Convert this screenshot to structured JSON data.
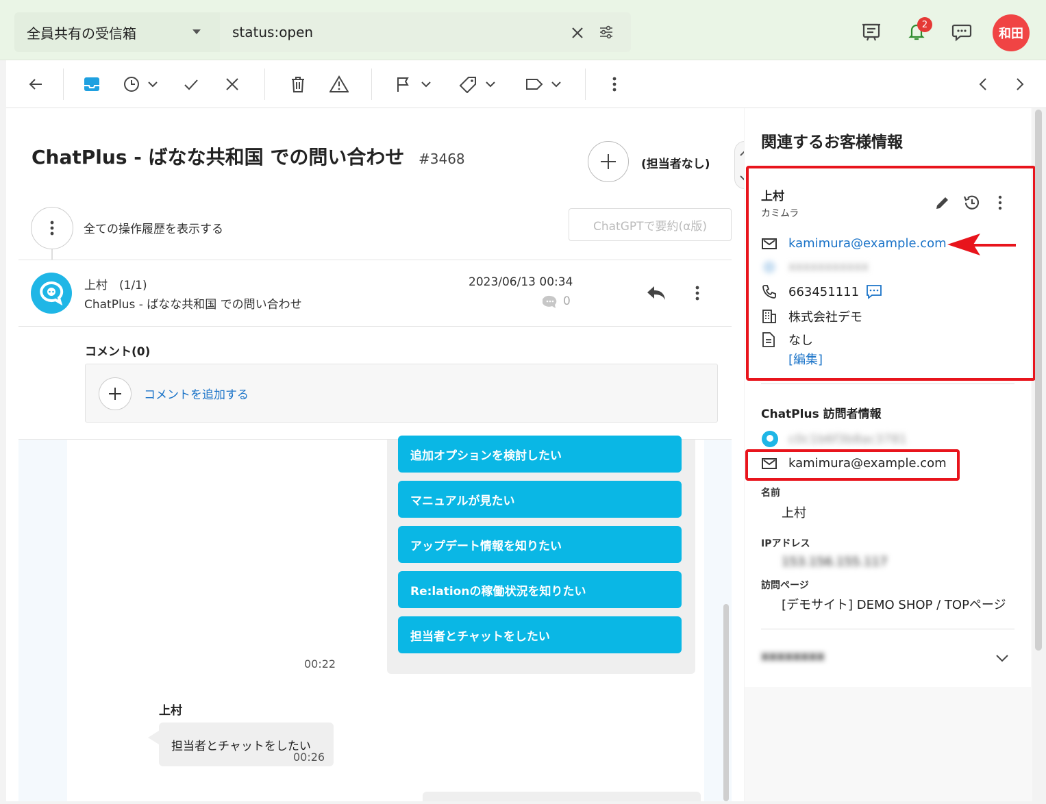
{
  "header": {
    "inbox": "全員共有の受信箱",
    "search_value": "status:open",
    "notification_count": "2",
    "user_initials": "和田"
  },
  "ticket": {
    "title": "ChatPlus - ばなな共和国 での問い合わせ",
    "number": "#3468",
    "assignee": "(担当者なし)",
    "history_label": "全ての操作履歴を表示する",
    "gpt_button": "ChatGPTで要約(α版)"
  },
  "message": {
    "from": "上村　(1/1)",
    "subject": "ChatPlus - ばなな共和国 での問い合わせ",
    "date": "2023/06/13 00:34",
    "comment_count": "0"
  },
  "comments": {
    "heading": "コメント(0)",
    "add_label": "コメントを追加する"
  },
  "chat": {
    "options": [
      "追加オプションを検討したい",
      "マニュアルが見たい",
      "アップデート情報を知りたい",
      "Re:lationの稼働状況を知りたい",
      "担当者とチャットをしたい"
    ],
    "bot_time": "00:22",
    "user_name": "上村",
    "user_message": "担当者とチャットをしたい",
    "user_time": "00:26"
  },
  "customer": {
    "section_title": "関連するお客様情報",
    "name": "上村",
    "kana": "カミムラ",
    "email": "kamimura@example.com",
    "blurred_contact": "xxxxxxxxxxx",
    "phone": "663451111",
    "company": "株式会社デモ",
    "memo": "なし",
    "edit_link": "[編集]"
  },
  "visitor": {
    "section_title": "ChatPlus 訪問者情報",
    "visitor_id": "c0c1b6f3b8ac3781",
    "email": "kamimura@example.com",
    "name_label": "名前",
    "name_value": "上村",
    "ip_label": "IPアドレス",
    "ip_value": "153.156.155.117",
    "page_label": "訪問ページ",
    "page_value": "[デモサイト] DEMO SHOP / TOPページ",
    "collapsed_section": "xxxxxxxx"
  },
  "colors": {
    "accent": "#0ab7e5",
    "link": "#1a73c8",
    "highlight": "#e8141c"
  }
}
